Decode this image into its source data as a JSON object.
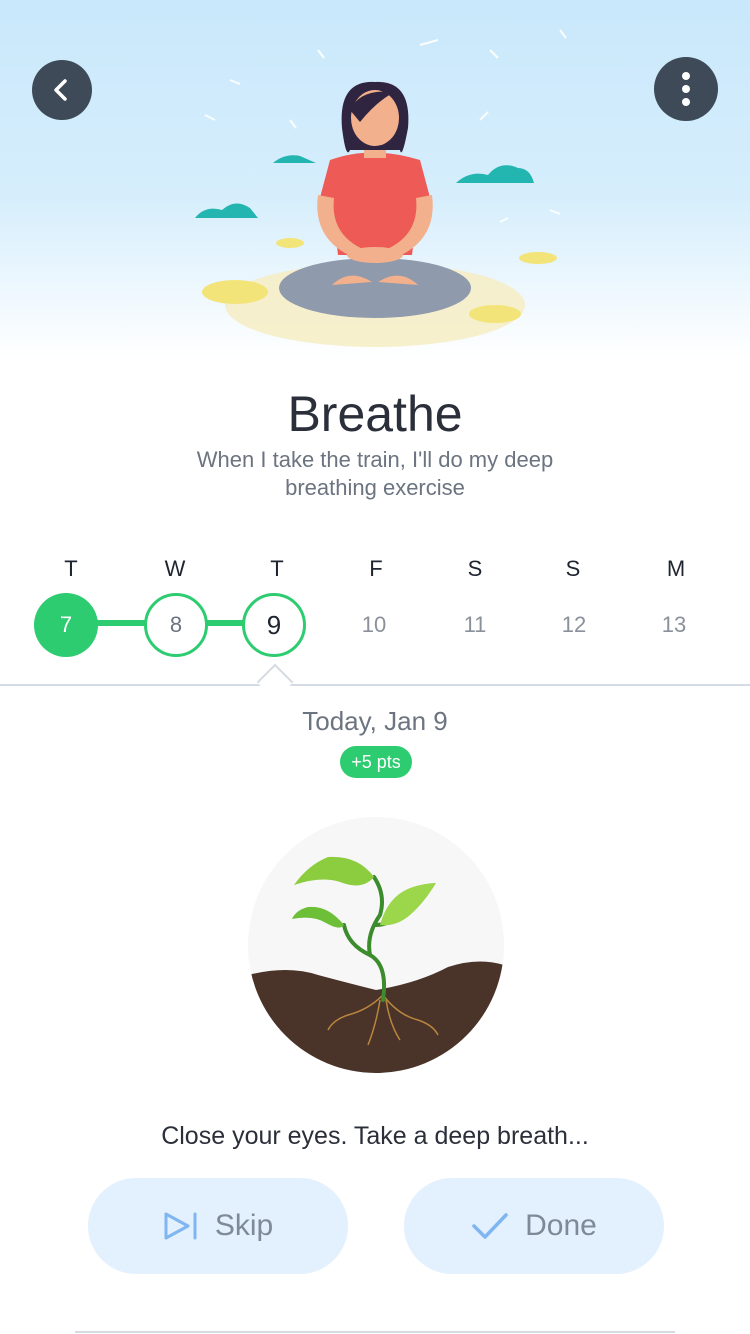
{
  "header": {
    "back_icon": "chevron-left-icon",
    "more_icon": "more-vertical-icon"
  },
  "habit": {
    "title": "Breathe",
    "subtitle": "When I take the train, I'll do my deep breathing exercise"
  },
  "week": {
    "days": [
      {
        "dow": "T",
        "num": "7",
        "state": "done"
      },
      {
        "dow": "W",
        "num": "8",
        "state": "ring"
      },
      {
        "dow": "T",
        "num": "9",
        "state": "today"
      },
      {
        "dow": "F",
        "num": "10",
        "state": "future"
      },
      {
        "dow": "S",
        "num": "11",
        "state": "future"
      },
      {
        "dow": "S",
        "num": "12",
        "state": "future"
      },
      {
        "dow": "M",
        "num": "13",
        "state": "future"
      }
    ]
  },
  "today": {
    "date_label": "Today, Jan 9",
    "points": "+5 pts"
  },
  "prompt": "Close your eyes. Take a deep breath...",
  "actions": {
    "skip_label": "Skip",
    "done_label": "Done",
    "skip_icon": "skip-forward-icon",
    "done_icon": "check-icon"
  },
  "colors": {
    "accent_green": "#2ecc71",
    "button_bg": "#e3f0fd",
    "dark_button": "#3e4a57",
    "soil": "#4a3328"
  }
}
